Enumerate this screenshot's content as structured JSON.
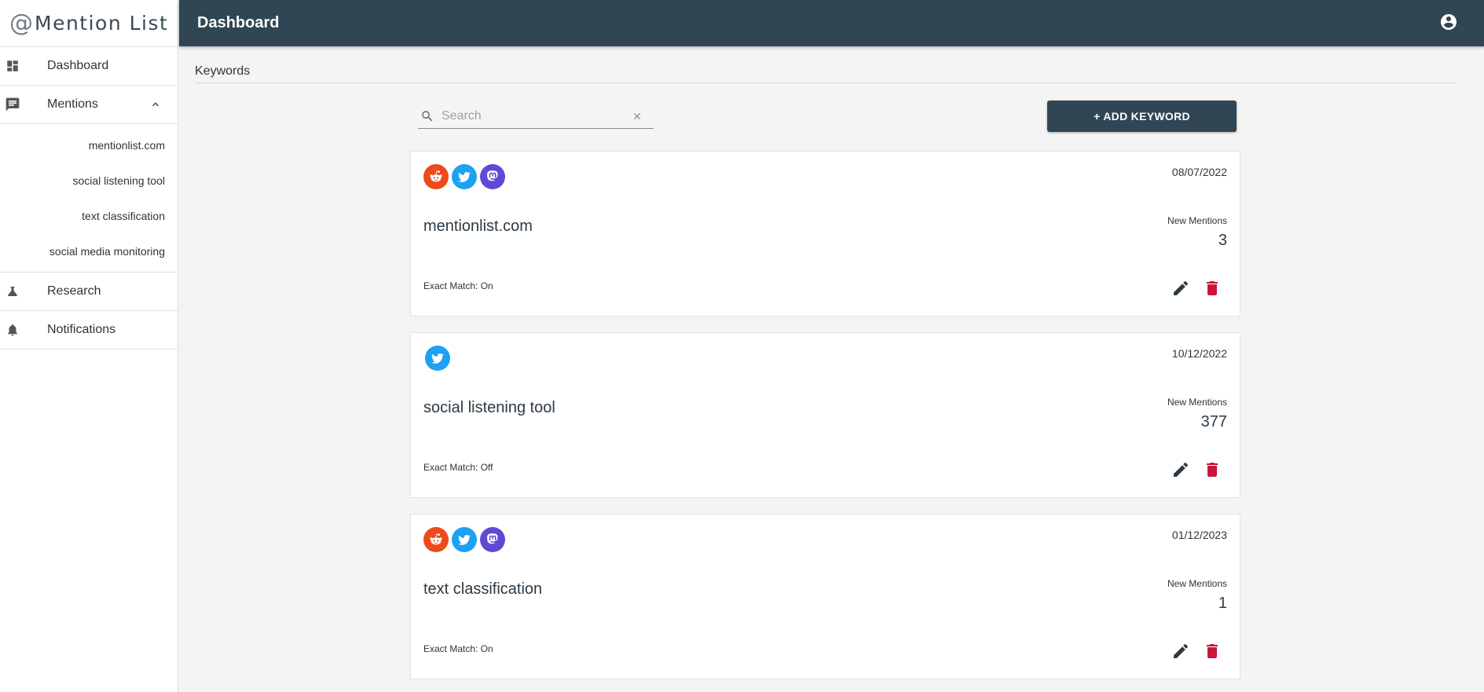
{
  "app": {
    "logo_at": "@",
    "logo_text": "Mention List"
  },
  "sidebar": {
    "dashboard": {
      "label": "Dashboard",
      "icon": "dashboard-icon"
    },
    "mentions": {
      "label": "Mentions",
      "icon": "chat-icon",
      "expanded": true,
      "items": [
        {
          "label": "mentionlist.com"
        },
        {
          "label": "social listening tool"
        },
        {
          "label": "text classification"
        },
        {
          "label": "social media monitoring"
        }
      ]
    },
    "research": {
      "label": "Research",
      "icon": "flask-icon"
    },
    "notifications": {
      "label": "Notifications",
      "icon": "bell-icon"
    }
  },
  "topbar": {
    "title": "Dashboard",
    "account_icon": "account-circle-icon"
  },
  "main": {
    "section_title": "Keywords",
    "search": {
      "placeholder": "Search",
      "value": ""
    },
    "add_button": "+ ADD KEYWORD",
    "new_mentions_label": "New Mentions",
    "cards": [
      {
        "keyword": "mentionlist.com",
        "date": "08/07/2022",
        "sources": [
          "reddit",
          "twitter",
          "mastodon"
        ],
        "new_mentions": "3",
        "exact_match": "Exact Match: On"
      },
      {
        "keyword": "social listening tool",
        "date": "10/12/2022",
        "sources": [
          "twitter"
        ],
        "new_mentions": "377",
        "exact_match": "Exact Match: Off"
      },
      {
        "keyword": "text classification",
        "date": "01/12/2023",
        "sources": [
          "reddit",
          "twitter",
          "mastodon"
        ],
        "new_mentions": "1",
        "exact_match": "Exact Match: On"
      }
    ]
  },
  "colors": {
    "primary": "#304655",
    "delete": "#c8173a",
    "reddit": "#ec4b1c",
    "twitter": "#1da1f2",
    "mastodon": "#6049d5"
  }
}
